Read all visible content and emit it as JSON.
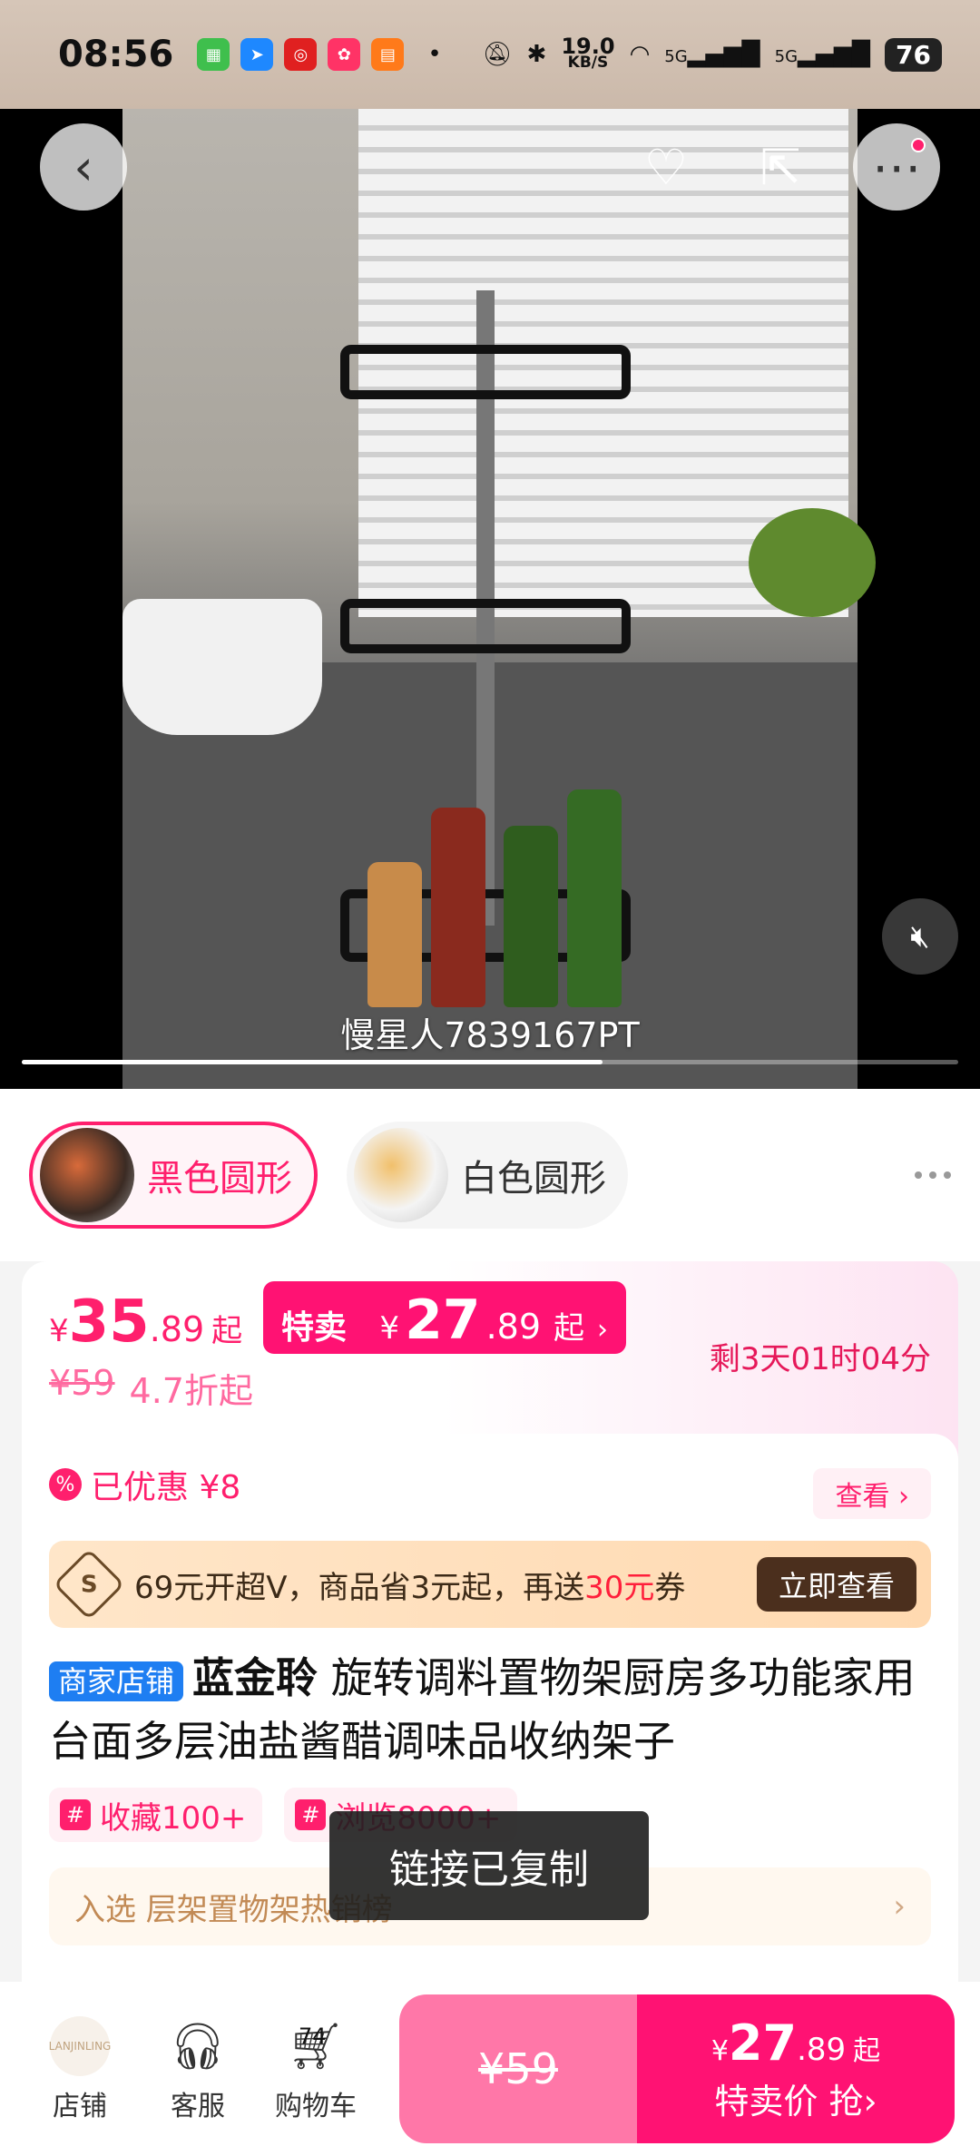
{
  "status_bar": {
    "time": "08:56",
    "speed_value": "19.0",
    "speed_unit": "KB/S",
    "network_1": "5G",
    "network_2": "5G",
    "battery": "76"
  },
  "media": {
    "caption": "慢星人7839167PT",
    "progress": 0.62
  },
  "variants": [
    {
      "label": "黑色圆形",
      "selected": true
    },
    {
      "label": "白色圆形",
      "selected": false
    }
  ],
  "price": {
    "currency": "¥",
    "int": "35",
    "dec": ".89",
    "suffix": "起",
    "special_label": "特卖价",
    "special_int": "27",
    "special_dec": ".89",
    "special_suffix": "起",
    "special_chevron": "›",
    "countdown": "剩3天01时04分",
    "original": "¥59",
    "discount": "4.7折起"
  },
  "coupon": {
    "icon_text": "%",
    "saved_text": "已优惠 ¥8",
    "view_label": "查看 ›"
  },
  "vip": {
    "icon_text": "S",
    "text_before": "69元开超V，商品省3元起，再送",
    "text_highlight": "30元",
    "text_after": "券",
    "button_label": "立即查看"
  },
  "product": {
    "store_tag": "商家店铺",
    "brand": "蓝金聆",
    "title": " 旋转调料置物架厨房多功能家用台面多层油盐酱醋调味品收纳架子"
  },
  "chips": [
    {
      "hash": "#",
      "label": "收藏100+"
    },
    {
      "hash": "#",
      "label": "浏览8000+"
    }
  ],
  "rank": {
    "label": "入选 层架置物架热销榜",
    "arrow": "›"
  },
  "toast": "链接已复制",
  "bottom_bar": {
    "store_logo_text": "LANJINLING",
    "store_label": "店铺",
    "service_label": "客服",
    "cart_label": "购物车",
    "cart_count": "74",
    "buy_original": "¥59",
    "buy_currency": "¥",
    "buy_int": "27",
    "buy_dec": ".89",
    "buy_suffix": "起",
    "buy_label": "特卖价 抢›"
  }
}
